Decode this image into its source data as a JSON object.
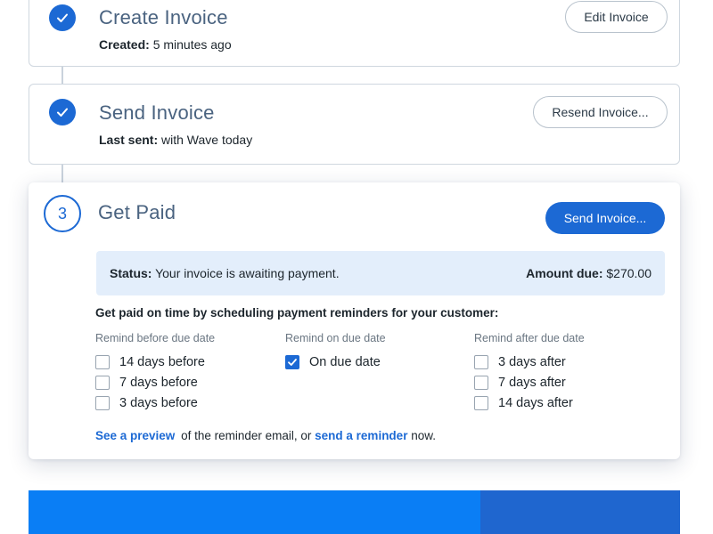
{
  "steps": [
    {
      "title": "Create Invoice",
      "meta_label": "Created:",
      "meta_value": "5 minutes ago",
      "button": "Edit Invoice",
      "status": "complete"
    },
    {
      "title": "Send Invoice",
      "meta_label": "Last sent:",
      "meta_value": "with Wave today",
      "button": "Resend Invoice...",
      "status": "complete"
    },
    {
      "number": "3",
      "title": "Get Paid",
      "button": "Send Invoice...",
      "status": "active"
    }
  ],
  "get_paid": {
    "status_label": "Status:",
    "status_value": "Your invoice is awaiting payment.",
    "amount_label": "Amount due:",
    "amount_value": "$270.00",
    "reminder_heading": "Get paid on time by scheduling payment reminders for your customer:",
    "columns": [
      {
        "label": "Remind before due date",
        "options": [
          {
            "label": "14 days before",
            "checked": false
          },
          {
            "label": "7 days before",
            "checked": false
          },
          {
            "label": "3 days before",
            "checked": false
          }
        ]
      },
      {
        "label": "Remind on due date",
        "options": [
          {
            "label": "On due date",
            "checked": true
          }
        ]
      },
      {
        "label": "Remind after due date",
        "options": [
          {
            "label": "3 days after",
            "checked": false
          },
          {
            "label": "7 days after",
            "checked": false
          },
          {
            "label": "14 days after",
            "checked": false
          }
        ]
      }
    ],
    "footer": {
      "preview_link": "See a preview",
      "text_middle": "of the reminder email, or",
      "reminder_link": "send a reminder",
      "text_end": "now."
    }
  },
  "colors": {
    "accent": "#1c69d4",
    "status_bg": "#e3eefb",
    "bottom_left": "#0a7ef5",
    "bottom_right": "#1f66cf",
    "title": "#4a6380"
  },
  "icons": {
    "complete": "check-icon",
    "unchecked": "checkbox-unchecked",
    "checked": "checkbox-checked"
  }
}
